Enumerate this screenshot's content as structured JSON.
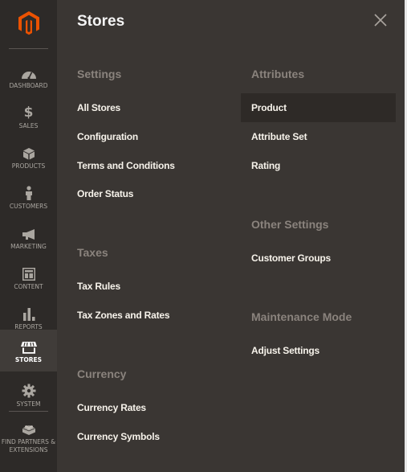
{
  "sidebar": {
    "logo": "magento-logo",
    "items": [
      {
        "label": "Dashboard",
        "icon": "dashboard-gauge-icon"
      },
      {
        "label": "Sales",
        "icon": "dollar-icon"
      },
      {
        "label": "Products",
        "icon": "box-icon"
      },
      {
        "label": "Customers",
        "icon": "person-icon"
      },
      {
        "label": "Marketing",
        "icon": "megaphone-icon"
      },
      {
        "label": "Content",
        "icon": "layout-icon"
      },
      {
        "label": "Reports",
        "icon": "bar-chart-icon"
      },
      {
        "label": "Stores",
        "icon": "storefront-icon",
        "active": true
      },
      {
        "label": "System",
        "icon": "gear-icon"
      },
      {
        "label": "Find Partners & Extensions",
        "icon": "lego-brick-icon"
      }
    ],
    "colors": {
      "background": "#2d2a28",
      "active_background": "#403c39",
      "logo": "#eb5202"
    }
  },
  "panel": {
    "title": "Stores",
    "close_icon": "close-icon",
    "left_column": [
      {
        "title": "Settings",
        "links": [
          "All Stores",
          "Configuration",
          "Terms and Conditions",
          "Order Status"
        ]
      },
      {
        "title": "Taxes",
        "links": [
          "Tax Rules",
          "Tax Zones and Rates"
        ]
      },
      {
        "title": "Currency",
        "links": [
          "Currency Rates",
          "Currency Symbols"
        ]
      }
    ],
    "right_column": [
      {
        "title": "Attributes",
        "links": [
          "Product",
          "Attribute Set",
          "Rating"
        ]
      },
      {
        "title": "Other Settings",
        "links": [
          "Customer Groups"
        ]
      },
      {
        "title": "Maintenance Mode",
        "links": [
          "Adjust Settings"
        ]
      }
    ],
    "hovered_link": "Product",
    "colors": {
      "background": "#3a3633",
      "section_title": "#8a837d",
      "link": "#f7f3eb"
    }
  }
}
